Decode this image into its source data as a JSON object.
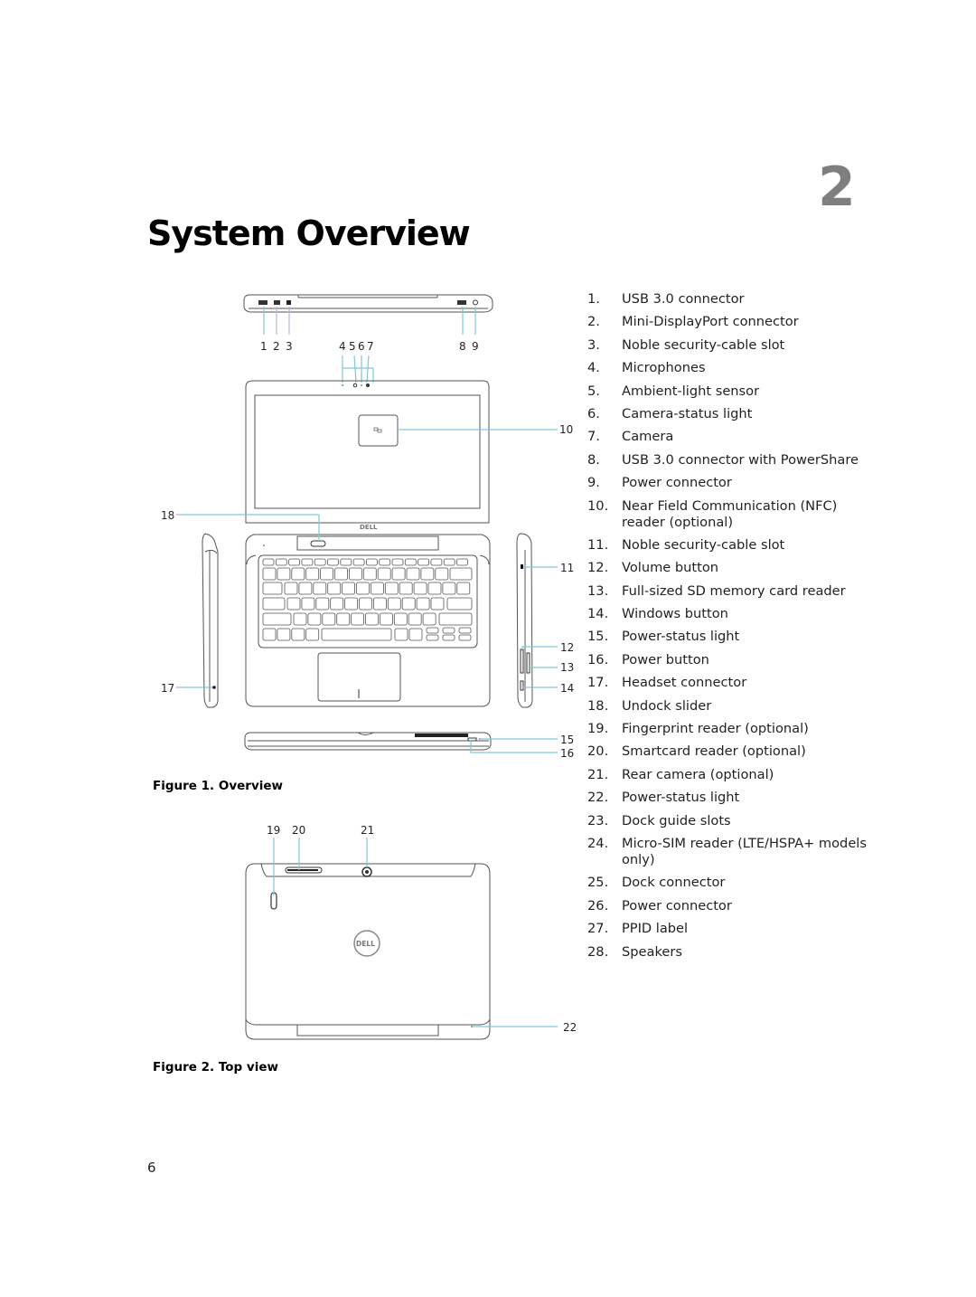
{
  "page": {
    "chapter_number": "2",
    "title": "System Overview",
    "page_number": "6"
  },
  "figures": [
    {
      "caption": "Figure 1. Overview",
      "callouts": [
        "1",
        "2",
        "3",
        "4",
        "5",
        "6",
        "7",
        "8",
        "9",
        "10",
        "11",
        "12",
        "13",
        "14",
        "15",
        "16",
        "17",
        "18"
      ],
      "logo_text": "DELL"
    },
    {
      "caption": "Figure 2. Top view",
      "callouts": [
        "19",
        "20",
        "21",
        "22"
      ],
      "logo_text": "DELL"
    }
  ],
  "legend": [
    {
      "num": "1.",
      "text": "USB 3.0 connector"
    },
    {
      "num": "2.",
      "text": "Mini-DisplayPort connector"
    },
    {
      "num": "3.",
      "text": "Noble security-cable slot"
    },
    {
      "num": "4.",
      "text": "Microphones"
    },
    {
      "num": "5.",
      "text": "Ambient-light sensor"
    },
    {
      "num": "6.",
      "text": "Camera-status light"
    },
    {
      "num": "7.",
      "text": "Camera"
    },
    {
      "num": "8.",
      "text": "USB 3.0 connector with PowerShare"
    },
    {
      "num": "9.",
      "text": "Power connector"
    },
    {
      "num": "10.",
      "text": "Near Field Communication (NFC) reader (optional)"
    },
    {
      "num": "11.",
      "text": "Noble security-cable slot"
    },
    {
      "num": "12.",
      "text": "Volume button"
    },
    {
      "num": "13.",
      "text": "Full-sized SD memory card reader"
    },
    {
      "num": "14.",
      "text": "Windows button"
    },
    {
      "num": "15.",
      "text": "Power-status light"
    },
    {
      "num": "16.",
      "text": "Power button"
    },
    {
      "num": "17.",
      "text": "Headset connector"
    },
    {
      "num": "18.",
      "text": "Undock slider"
    },
    {
      "num": "19.",
      "text": "Fingerprint reader (optional)"
    },
    {
      "num": "20.",
      "text": "Smartcard reader (optional)"
    },
    {
      "num": "21.",
      "text": "Rear camera (optional)"
    },
    {
      "num": "22.",
      "text": "Power-status light"
    },
    {
      "num": "23.",
      "text": "Dock guide slots"
    },
    {
      "num": "24.",
      "text": "Micro-SIM reader (LTE/HSPA+ models only)"
    },
    {
      "num": "25.",
      "text": "Dock connector"
    },
    {
      "num": "26.",
      "text": "Power connector"
    },
    {
      "num": "27.",
      "text": "PPID label"
    },
    {
      "num": "28.",
      "text": "Speakers"
    }
  ],
  "colors": {
    "leader_line": "#7fc8d6",
    "chapter_number": "#7f7f7f",
    "outline": "#555555"
  }
}
